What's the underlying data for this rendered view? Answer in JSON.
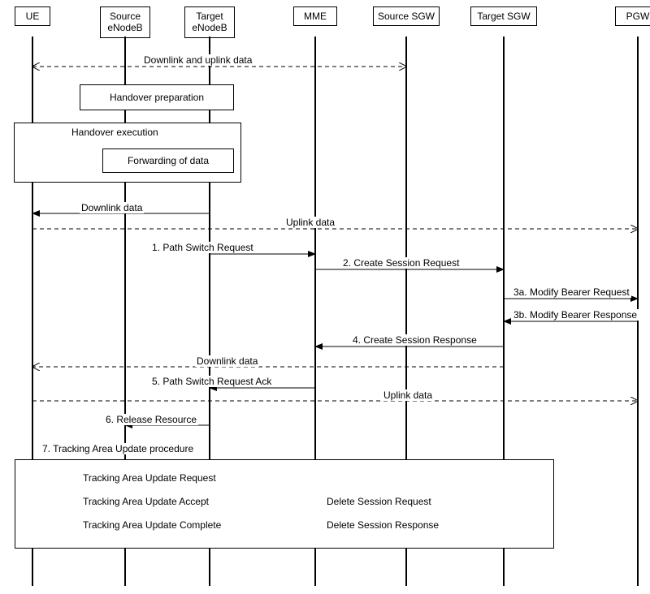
{
  "participants": {
    "ue": "UE",
    "srcEnb": "Source\neNodeB",
    "tgtEnb": "Target\neNodeB",
    "mme": "MME",
    "srcSgw": "Source SGW",
    "tgtSgw": "Target  SGW",
    "pgw": "PGW"
  },
  "phases": {
    "prep": "Handover preparation",
    "exec": "Handover execution",
    "fwd": "Forwarding of data"
  },
  "messages": {
    "dlul": "Downlink and uplink data",
    "dl1": "Downlink data",
    "ul1": "Uplink data",
    "m1": "1. Path Switch Request",
    "m2": "2. Create Session Request",
    "m3a": "3a. Modify Bearer Request",
    "m3b": "3b. Modify Bearer Response",
    "m4": "4. Create Session Response",
    "dl2": "Downlink data",
    "m5": "5. Path Switch Request Ack",
    "ul2": "Uplink data",
    "m6": "6. Release Resource",
    "m7": "7. Tracking Area Update procedure",
    "tauReq": "Tracking Area Update Request",
    "tauAcc": "Tracking Area Update Accept",
    "delReq": "Delete Session Request",
    "tauComp": "Tracking Area Update Complete",
    "delResp": "Delete Session Response"
  }
}
